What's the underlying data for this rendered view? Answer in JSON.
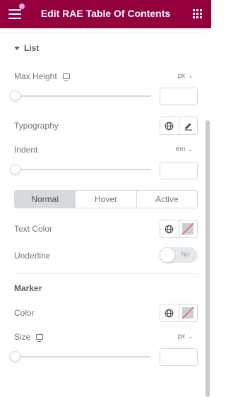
{
  "header": {
    "title": "Edit RAE Table Of Contents",
    "menu_icon": "hamburger-icon",
    "apps_icon": "grid-icon",
    "accent_color": "#93003c"
  },
  "section": {
    "title": "List"
  },
  "max_height": {
    "label": "Max Height",
    "unit": "px",
    "value": ""
  },
  "typography": {
    "label": "Typography"
  },
  "indent": {
    "label": "Indent",
    "unit": "em",
    "value": ""
  },
  "state_tabs": [
    {
      "label": "Normal",
      "active": true
    },
    {
      "label": "Hover",
      "active": false
    },
    {
      "label": "Active",
      "active": false
    }
  ],
  "text_color": {
    "label": "Text Color"
  },
  "underline": {
    "label": "Underline",
    "toggle_text": "No"
  },
  "marker": {
    "heading": "Marker",
    "color_label": "Color",
    "size_label": "Size",
    "size_unit": "px",
    "size_value": ""
  }
}
